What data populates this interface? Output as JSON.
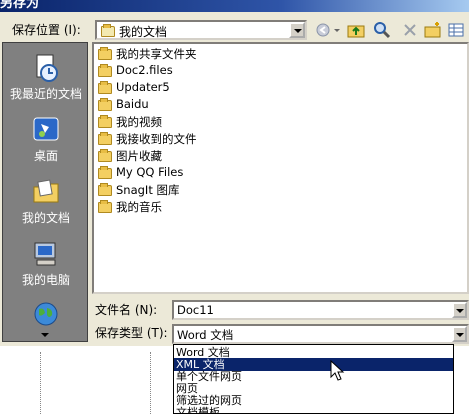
{
  "window": {
    "title": "另存为"
  },
  "save_in": {
    "label": "保存位置 (I):",
    "value": "我的文档"
  },
  "toolbar": {
    "back_icon": "back-arrow-icon",
    "up_icon": "up-folder-icon",
    "search_icon": "search-icon",
    "delete_icon": "delete-icon",
    "new_folder_icon": "new-folder-icon",
    "views_icon": "views-icon"
  },
  "places": [
    {
      "label": "我最近的文档",
      "icon": "recent-documents-icon"
    },
    {
      "label": "桌面",
      "icon": "desktop-icon"
    },
    {
      "label": "我的文档",
      "icon": "my-documents-icon"
    },
    {
      "label": "我的电脑",
      "icon": "my-computer-icon"
    }
  ],
  "files": [
    "我的共享文件夹",
    "Doc2.files",
    "Updater5",
    "Baidu",
    "我的视频",
    "我接收到的文件",
    "图片收藏",
    "My QQ Files",
    "SnagIt 图库",
    "我的音乐"
  ],
  "filename": {
    "label": "文件名 (N):",
    "value": "Doc11"
  },
  "filetype": {
    "label": "保存类型 (T):",
    "value": "Word 文档",
    "options": [
      "Word 文档",
      "XML 文档",
      "单个文件网页",
      "网页",
      "筛选过的网页",
      "文档模板"
    ],
    "highlighted_index": 1
  },
  "colors": {
    "title_bar": "#0a246a",
    "selection": "#0a246a",
    "places_bg": "#808080",
    "dialog_bg": "#ece9d8"
  }
}
